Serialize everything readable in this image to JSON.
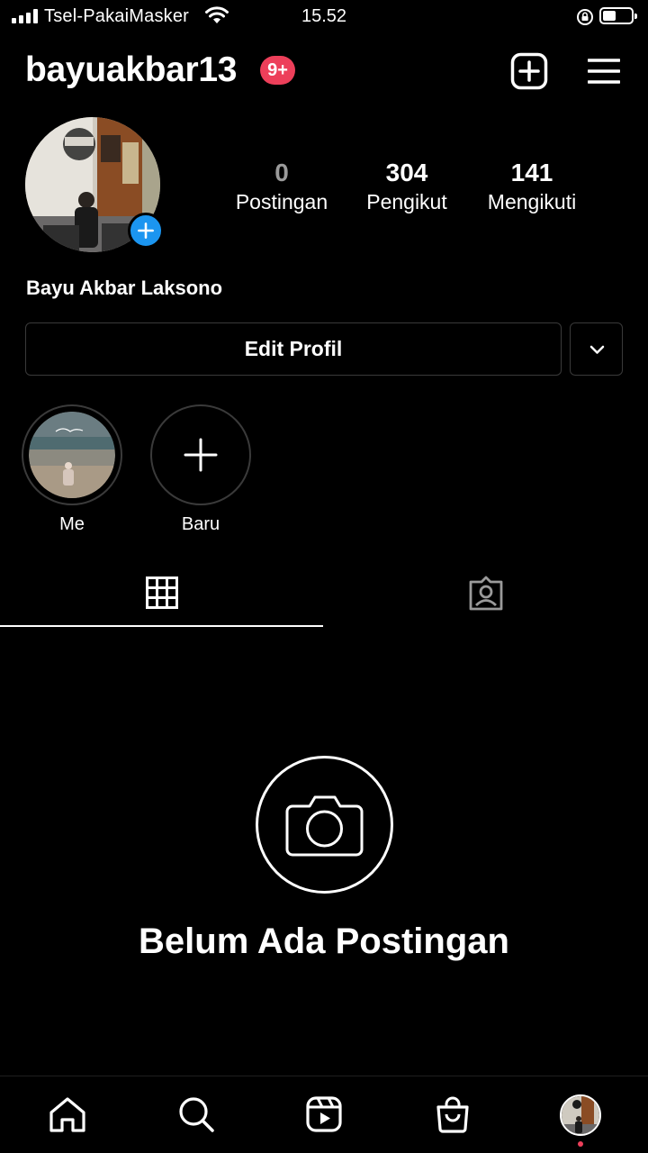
{
  "status_bar": {
    "carrier": "Tsel-PakaiMasker",
    "time": "15.52",
    "icons": [
      "signal-icon",
      "wifi-icon",
      "rotation-lock-icon",
      "battery-icon"
    ]
  },
  "header": {
    "username": "bayuakbar13",
    "notification_badge": "9+",
    "icons": [
      "new-post-icon",
      "menu-icon"
    ]
  },
  "profile": {
    "avatar_icon": "avatar",
    "stats": [
      {
        "value": "0",
        "label": "Postingan"
      },
      {
        "value": "304",
        "label": "Pengikut"
      },
      {
        "value": "141",
        "label": "Mengikuti"
      }
    ],
    "full_name": "Bayu Akbar Laksono",
    "edit_button": "Edit Profil"
  },
  "highlights": [
    {
      "label": "Me"
    },
    {
      "label": "Baru"
    }
  ],
  "tabs": {
    "active": "grid",
    "items": [
      "grid-icon",
      "tagged-icon"
    ]
  },
  "empty_state": {
    "title": "Belum Ada Postingan",
    "icon": "camera-icon"
  },
  "bottom_nav": {
    "items": [
      "home-icon",
      "search-icon",
      "reels-icon",
      "shop-icon",
      "profile-avatar"
    ]
  },
  "colors": {
    "background": "#000000",
    "badge": "#ed3f5a",
    "accent_blue": "#1b95f0",
    "border": "#3a3a3a"
  }
}
